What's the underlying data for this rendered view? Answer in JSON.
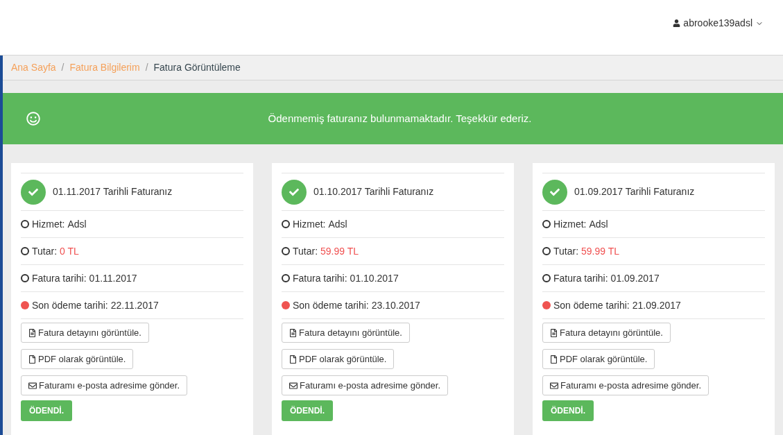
{
  "user_menu": {
    "username": "abrooke139adsl"
  },
  "breadcrumb_separator": "/",
  "breadcrumb": [
    {
      "label": "Ana Sayfa",
      "current": false
    },
    {
      "label": "Fatura Bilgilerim",
      "current": false
    },
    {
      "label": "Fatura Görüntüleme",
      "current": true
    }
  ],
  "alert": {
    "message": "Ödenmemiş faturanız bulunmamaktadır. Teşekkür ederiz."
  },
  "invoices": [
    {
      "title": "01.11.2017 Tarihli Faturanız",
      "details": [
        {
          "kind": "open",
          "label": "Hizmet:",
          "value": "Adsl",
          "highlight": false
        },
        {
          "kind": "open",
          "label": "Tutar:",
          "value": "0 TL",
          "highlight": true
        },
        {
          "kind": "open",
          "label": "Fatura tarihi:",
          "value": "01.11.2017",
          "highlight": false
        },
        {
          "kind": "due",
          "label": "Son ödeme tarihi:",
          "value": "22.11.2017",
          "highlight": false
        }
      ],
      "actions": [
        {
          "kind": "detail",
          "label": "Fatura detayını görüntüle."
        },
        {
          "kind": "pdf",
          "label": "PDF olarak görüntüle."
        },
        {
          "kind": "email",
          "label": "Faturamı e-posta adresime gönder."
        }
      ],
      "status": "ÖDENDİ."
    },
    {
      "title": "01.10.2017 Tarihli Faturanız",
      "details": [
        {
          "kind": "open",
          "label": "Hizmet:",
          "value": "Adsl",
          "highlight": false
        },
        {
          "kind": "open",
          "label": "Tutar:",
          "value": "59.99 TL",
          "highlight": true
        },
        {
          "kind": "open",
          "label": "Fatura tarihi:",
          "value": "01.10.2017",
          "highlight": false
        },
        {
          "kind": "due",
          "label": "Son ödeme tarihi:",
          "value": "23.10.2017",
          "highlight": false
        }
      ],
      "actions": [
        {
          "kind": "detail",
          "label": "Fatura detayını görüntüle."
        },
        {
          "kind": "pdf",
          "label": "PDF olarak görüntüle."
        },
        {
          "kind": "email",
          "label": "Faturamı e-posta adresime gönder."
        }
      ],
      "status": "ÖDENDİ."
    },
    {
      "title": "01.09.2017 Tarihli Faturanız",
      "details": [
        {
          "kind": "open",
          "label": "Hizmet:",
          "value": "Adsl",
          "highlight": false
        },
        {
          "kind": "open",
          "label": "Tutar:",
          "value": "59.99 TL",
          "highlight": true
        },
        {
          "kind": "open",
          "label": "Fatura tarihi:",
          "value": "01.09.2017",
          "highlight": false
        },
        {
          "kind": "due",
          "label": "Son ödeme tarihi:",
          "value": "21.09.2017",
          "highlight": false
        }
      ],
      "actions": [
        {
          "kind": "detail",
          "label": "Fatura detayını görüntüle."
        },
        {
          "kind": "pdf",
          "label": "PDF olarak görüntüle."
        },
        {
          "kind": "email",
          "label": "Faturamı e-posta adresime gönder."
        }
      ],
      "status": "ÖDENDİ."
    }
  ]
}
